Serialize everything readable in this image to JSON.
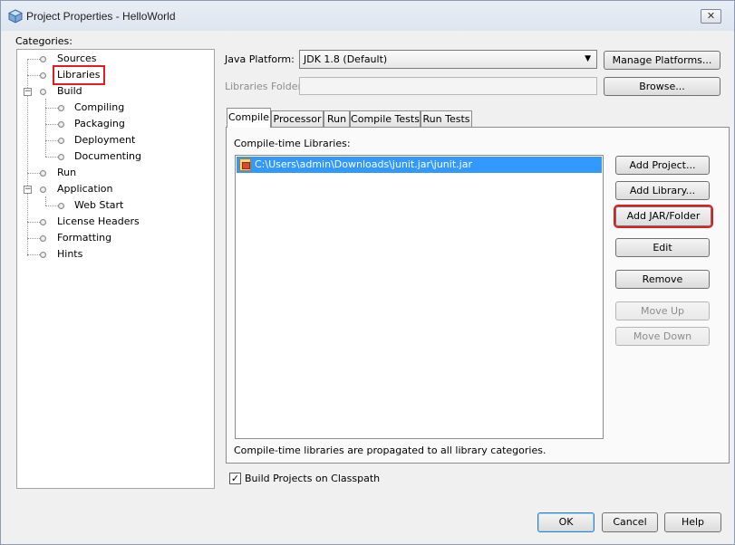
{
  "window": {
    "title": "Project Properties - HelloWorld",
    "close_glyph": "✕"
  },
  "categories": {
    "label": "Categories:",
    "items": [
      {
        "label": "Sources"
      },
      {
        "label": "Libraries",
        "selected": true
      },
      {
        "label": "Build",
        "expanded": true
      },
      {
        "label": "Compiling"
      },
      {
        "label": "Packaging"
      },
      {
        "label": "Deployment"
      },
      {
        "label": "Documenting"
      },
      {
        "label": "Run"
      },
      {
        "label": "Application",
        "expanded": true
      },
      {
        "label": "Web Start"
      },
      {
        "label": "License Headers"
      },
      {
        "label": "Formatting"
      },
      {
        "label": "Hints"
      }
    ]
  },
  "platform": {
    "label": "Java Platform:",
    "value": "JDK 1.8 (Default)",
    "manage_button": "Manage Platforms..."
  },
  "libraries_folder": {
    "label": "Libraries Folder:",
    "value": "",
    "browse_button": "Browse..."
  },
  "tabs": [
    {
      "label": "Compile",
      "active": true
    },
    {
      "label": "Processor"
    },
    {
      "label": "Run"
    },
    {
      "label": "Compile Tests"
    },
    {
      "label": "Run Tests"
    }
  ],
  "compile": {
    "list_label": "Compile-time Libraries:",
    "libraries": [
      "C:\\Users\\admin\\Downloads\\junit.jar\\junit.jar"
    ],
    "buttons": {
      "add_project": "Add Project...",
      "add_library": "Add Library...",
      "add_jar": "Add JAR/Folder",
      "edit": "Edit",
      "remove": "Remove",
      "move_up": "Move Up",
      "move_down": "Move Down"
    },
    "note": "Compile-time libraries are propagated to all library categories."
  },
  "build_on_classpath": {
    "label": "Build Projects on Classpath",
    "checked": true,
    "check_glyph": "✓"
  },
  "footer": {
    "ok": "OK",
    "cancel": "Cancel",
    "help": "Help"
  },
  "colors": {
    "highlight_box": "#e01e1e",
    "selection": "#3399ff"
  }
}
